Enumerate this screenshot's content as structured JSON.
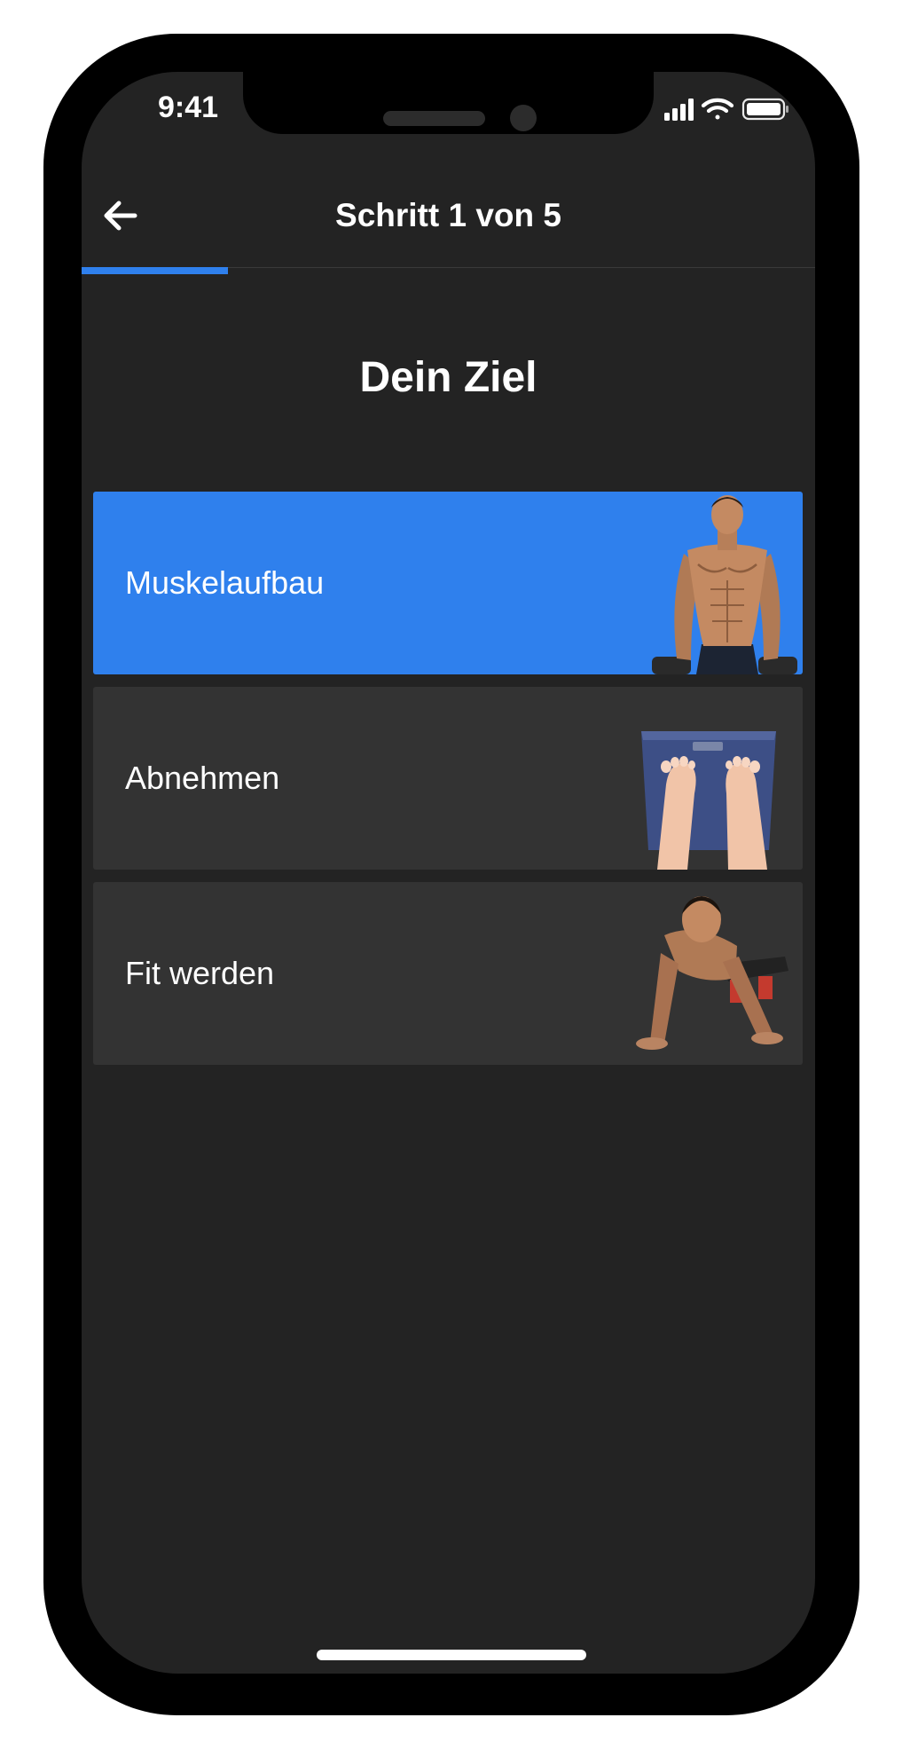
{
  "status_bar": {
    "time": "9:41",
    "icons": [
      "signal-icon",
      "wifi-icon",
      "battery-icon"
    ]
  },
  "nav": {
    "title": "Schritt 1 von 5",
    "back_icon": "arrow-left-icon"
  },
  "progress": {
    "current_step": 1,
    "total_steps": 5,
    "fraction": 0.2
  },
  "page": {
    "title": "Dein Ziel"
  },
  "options": [
    {
      "label": "Muskelaufbau",
      "selected": true,
      "image": "muscular-man-dumbbells"
    },
    {
      "label": "Abnehmen",
      "selected": false,
      "image": "feet-on-scale"
    },
    {
      "label": "Fit werden",
      "selected": false,
      "image": "man-push-up"
    }
  ],
  "colors": {
    "accent": "#2f80ed",
    "background": "#232323",
    "card": "#333333",
    "text": "#ffffff"
  }
}
